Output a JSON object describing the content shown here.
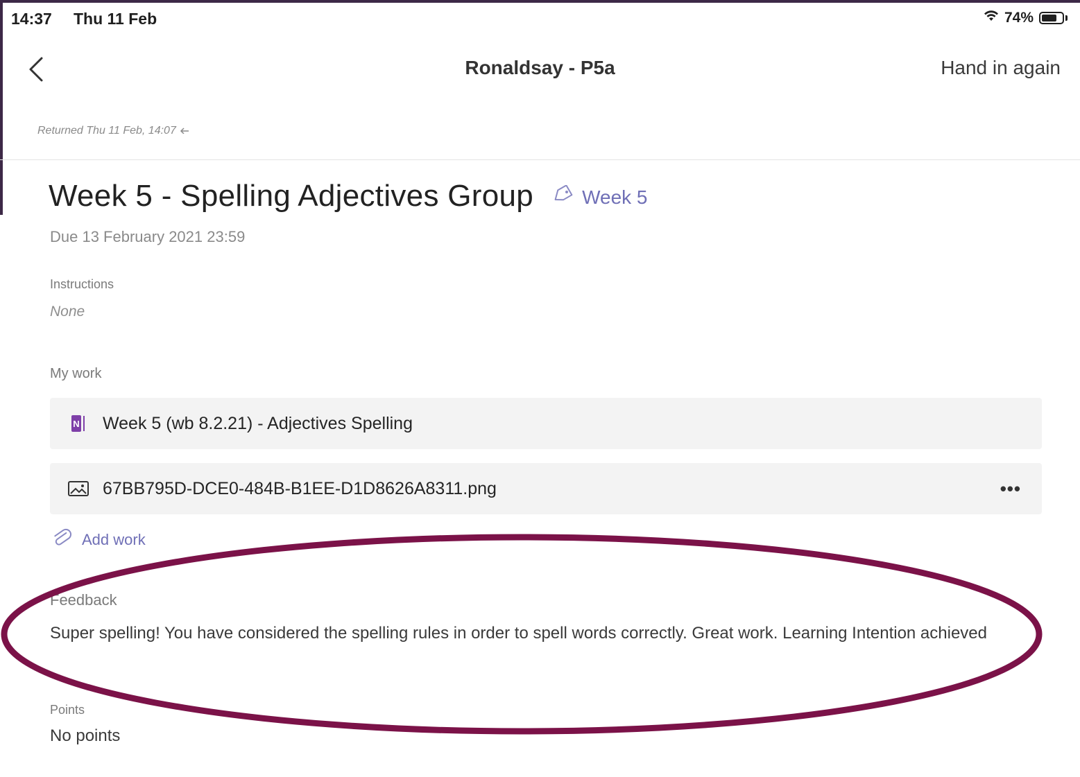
{
  "status_bar": {
    "time": "14:37",
    "day": "Thu 11 Feb",
    "battery_percent": "74%",
    "battery_level": 0.74
  },
  "nav": {
    "title": "Ronaldsay - P5a",
    "hand_in_label": "Hand in again"
  },
  "returned_text": "Returned Thu 11 Feb, 14:07",
  "assignment": {
    "title": "Week 5 - Spelling Adjectives Group",
    "tag": "Week 5",
    "due": "Due 13 February 2021 23:59"
  },
  "instructions": {
    "label": "Instructions",
    "value": "None"
  },
  "my_work": {
    "label": "My work",
    "items": [
      {
        "name": "Week 5 (wb 8.2.21) - Adjectives Spelling",
        "icon": "onenote-icon"
      },
      {
        "name": "67BB795D-DCE0-484B-B1EE-D1D8626A8311.png",
        "icon": "image-file-icon",
        "more": "•••"
      }
    ],
    "add_work_label": "Add work"
  },
  "feedback": {
    "label": "Feedback",
    "text": "Super spelling! You have considered the spelling rules in order to spell words correctly.  Great work. Learning Intention achieved"
  },
  "points": {
    "label": "Points",
    "value": "No points"
  },
  "colors": {
    "frame": "#3d2947",
    "accent": "#6f6fb6",
    "highlight": "#7b1248"
  }
}
